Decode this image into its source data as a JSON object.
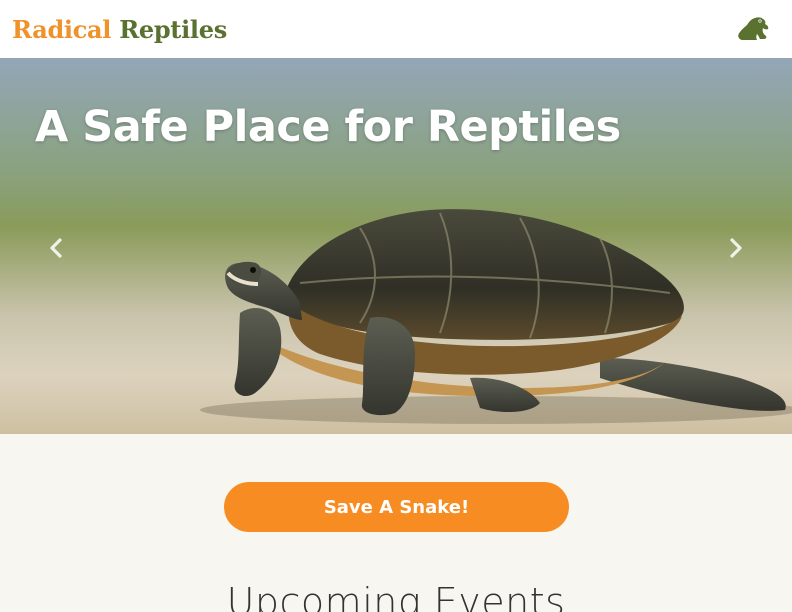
{
  "header": {
    "brand_part1": "Radical",
    "brand_part2": "Reptiles",
    "logo_icon": "frog-icon",
    "brand_color_1": "#f0912a",
    "brand_color_2": "#5a7130"
  },
  "carousel": {
    "title": "A Safe Place for Reptiles",
    "prev_icon": "chevron-left-icon",
    "next_icon": "chevron-right-icon"
  },
  "main": {
    "cta_label": "Save A Snake!",
    "cta_color": "#f78d22",
    "section_title": "Upcoming Events"
  }
}
